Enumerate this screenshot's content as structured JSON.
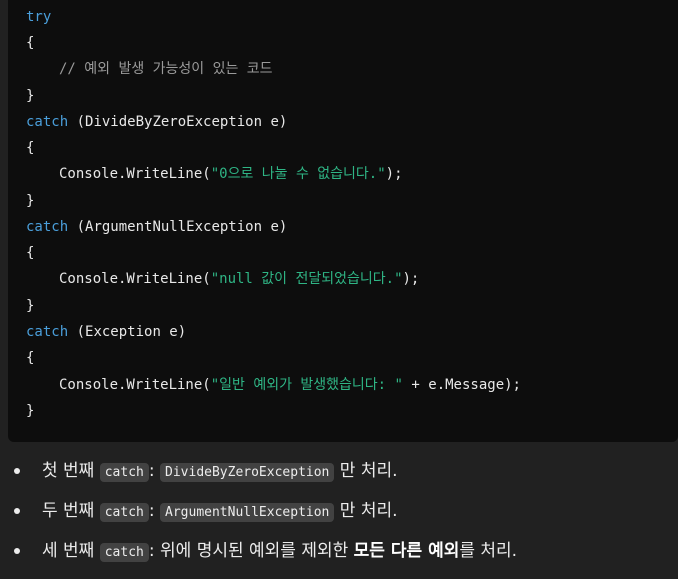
{
  "code": {
    "line1_try": "try",
    "line2_open": "{",
    "line3_comment": "// 예외 발생 가능성이 있는 코드",
    "line4_close": "}",
    "line5_catch": "catch",
    "line5_args": " (DivideByZeroException e)",
    "line6_open": "{",
    "line7_call": "Console.WriteLine(",
    "line7_string": "\"0으로 나눌 수 없습니다.\"",
    "line7_end": ");",
    "line8_close": "}",
    "line9_catch": "catch",
    "line9_args": " (ArgumentNullException e)",
    "line10_open": "{",
    "line11_call": "Console.WriteLine(",
    "line11_string": "\"null 값이 전달되었습니다.\"",
    "line11_end": ");",
    "line12_close": "}",
    "line13_catch": "catch",
    "line13_args": " (Exception e)",
    "line14_open": "{",
    "line15_call": "Console.WriteLine(",
    "line15_string": "\"일반 예외가 발생했습니다: \"",
    "line15_end": " + e.Message);",
    "line16_close": "}"
  },
  "bullets": [
    {
      "prefix": "첫 번째 ",
      "code1": "catch",
      "sep": ": ",
      "code2": "DivideByZeroException",
      "suffix": " 만 처리."
    },
    {
      "prefix": "두 번째 ",
      "code1": "catch",
      "sep": ": ",
      "code2": "ArgumentNullException",
      "suffix": " 만 처리."
    },
    {
      "prefix": "세 번째 ",
      "code1": "catch",
      "mid": ": 위에 명시된 예외를 제외한 ",
      "bold": "모든 다른 예외",
      "suffix": "를 처리."
    }
  ]
}
